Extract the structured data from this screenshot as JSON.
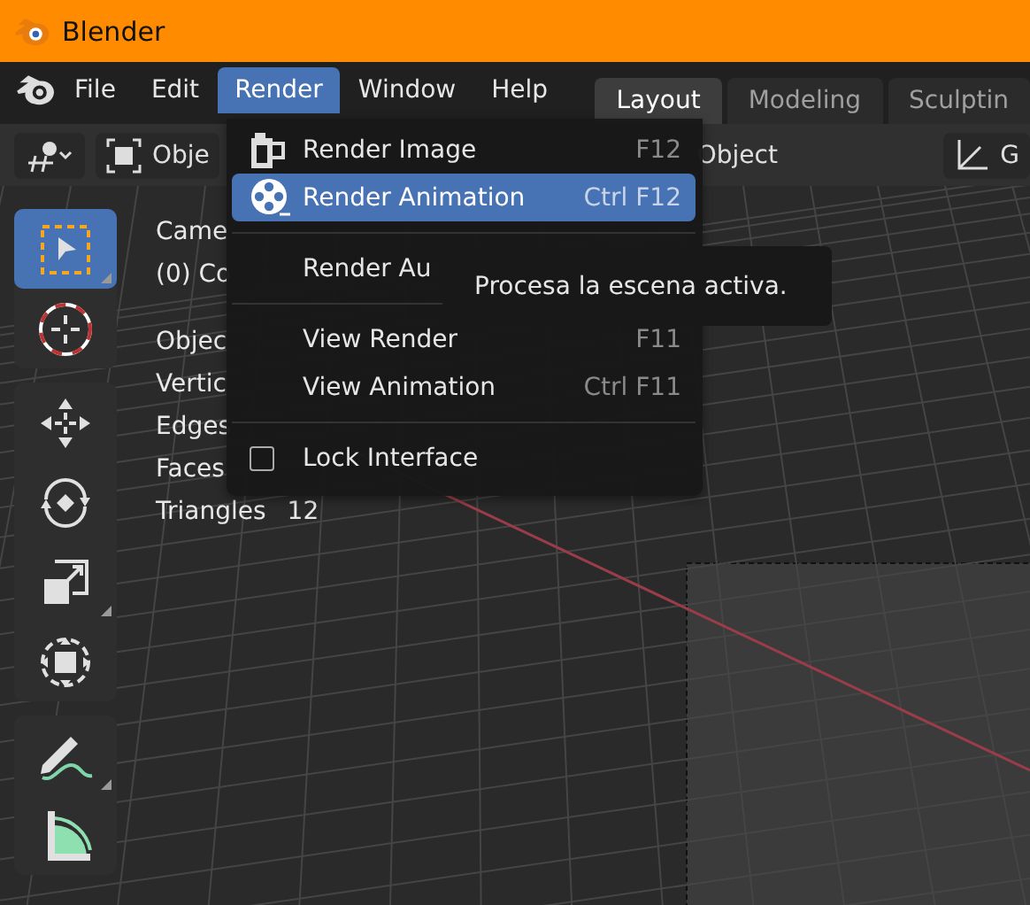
{
  "window": {
    "title": "Blender"
  },
  "menubar": {
    "items": [
      {
        "label": "File",
        "selected": false
      },
      {
        "label": "Edit",
        "selected": false
      },
      {
        "label": "Render",
        "selected": true
      },
      {
        "label": "Window",
        "selected": false
      },
      {
        "label": "Help",
        "selected": false
      }
    ]
  },
  "workspace_tabs": [
    {
      "label": "Layout",
      "selected": true
    },
    {
      "label": "Modeling",
      "selected": false
    },
    {
      "label": "Sculptin",
      "selected": false
    }
  ],
  "header": {
    "mode": "Obje",
    "object_menu": "Object",
    "orientation": "G"
  },
  "tools": [
    [
      {
        "kind": "select",
        "selected": true,
        "options": true
      },
      {
        "kind": "cursor",
        "selected": false,
        "options": false
      }
    ],
    [
      {
        "kind": "move",
        "selected": false,
        "options": false
      },
      {
        "kind": "rotate",
        "selected": false,
        "options": false
      },
      {
        "kind": "scale",
        "selected": false,
        "options": true
      },
      {
        "kind": "transform",
        "selected": false,
        "options": false
      }
    ],
    [
      {
        "kind": "annotate",
        "selected": false,
        "options": true
      },
      {
        "kind": "measure",
        "selected": false,
        "options": false
      }
    ]
  ],
  "viewport_info": {
    "lines": [
      "Came",
      "(0) Co"
    ],
    "stats": [
      {
        "label": "Objec"
      },
      {
        "label": "Vertic"
      },
      {
        "label": "Edges"
      },
      {
        "label": "Faces"
      },
      {
        "label": "Triangles",
        "value": "12"
      }
    ]
  },
  "render_menu": {
    "items": [
      {
        "kind": "item",
        "label": "Render Image",
        "shortcut": "F12",
        "highlighted": false
      },
      {
        "kind": "item",
        "label": "Render Animation",
        "shortcut": "Ctrl F12",
        "highlighted": true
      },
      {
        "kind": "separator"
      },
      {
        "kind": "item",
        "label": "Render Au",
        "highlighted": false
      },
      {
        "kind": "separator"
      },
      {
        "kind": "item",
        "label": "View Render",
        "shortcut": "F11",
        "highlighted": false
      },
      {
        "kind": "item",
        "label": "View Animation",
        "shortcut": "Ctrl F11",
        "highlighted": false
      },
      {
        "kind": "separator"
      },
      {
        "kind": "checkbox",
        "label": "Lock Interface",
        "checked": false
      }
    ]
  },
  "tooltip": {
    "text": "Procesa la escena activa."
  }
}
